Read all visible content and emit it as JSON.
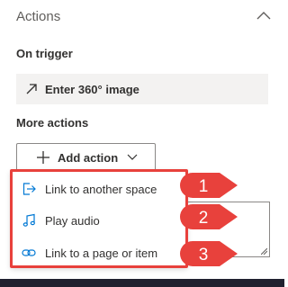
{
  "panel": {
    "title": "Actions",
    "on_trigger_label": "On trigger",
    "trigger_value": "Enter 360° image",
    "more_actions_label": "More actions",
    "add_action_label": "Add action"
  },
  "dropdown": {
    "items": [
      {
        "label": "Link to another space",
        "icon": "link-space-icon"
      },
      {
        "label": "Play audio",
        "icon": "music-note-icon"
      },
      {
        "label": "Link to a page or item",
        "icon": "link-chain-icon"
      }
    ]
  },
  "callouts": [
    "1",
    "2",
    "3"
  ],
  "colors": {
    "accent": "#0078d4",
    "highlight": "#e8413c",
    "bottom_bar": "#20212f"
  }
}
